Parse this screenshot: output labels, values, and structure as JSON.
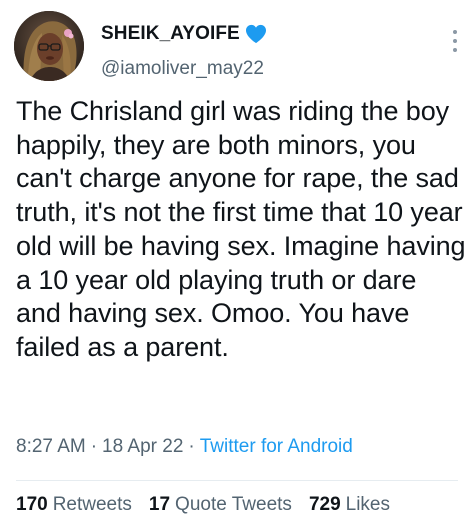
{
  "author": {
    "display_name": "SHEIK_AYOIFE",
    "handle": "@iamoliver_may22",
    "badge_icon": "blue-heart-icon",
    "badge_color": "#1d9bf0"
  },
  "tweet": {
    "text": "The Chrisland girl was riding the boy happily, they are both minors, you can't charge anyone for rape, the sad truth, it's not the first time that 10 year old will be having sex. Imagine having a 10 year old playing truth or dare and having sex. Omoo. You have failed as a parent.",
    "time": "8:27 AM",
    "separator": "·",
    "date": "18 Apr 22",
    "source": "Twitter for Android"
  },
  "stats": {
    "retweets_count": "170",
    "retweets_label": "Retweets",
    "quote_tweets_count": "17",
    "quote_tweets_label": "Quote Tweets",
    "likes_count": "729",
    "likes_label": "Likes"
  },
  "icons": {
    "more": "more-vertical-icon"
  },
  "colors": {
    "text_primary": "#0f1419",
    "text_secondary": "#536471",
    "link": "#1d9bf0",
    "divider": "#e6ecf0"
  }
}
